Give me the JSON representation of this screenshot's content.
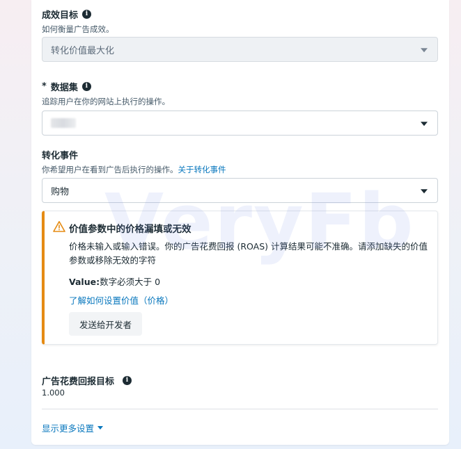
{
  "goal": {
    "title": "成效目标",
    "description": "如何衡量广告成效。",
    "selected": "转化价值最大化"
  },
  "dataset": {
    "required_mark": "*",
    "title": "数据集",
    "description": "追踪用户在你的网站上执行的操作。"
  },
  "conversion_event": {
    "title": "转化事件",
    "description": "你希望用户在看到广告后执行的操作。",
    "link": "关于转化事件",
    "selected": "购物"
  },
  "alert": {
    "title": "价值参数中的价格漏填或无效",
    "body": "价格未输入或输入错误。你的广告花费回报 (ROAS) 计算结果可能不准确。请添加缺失的价值参数或移除无效的字符",
    "value_label": "Value:",
    "value_text": "数字必须大于 0",
    "link": "了解如何设置价值（价格）",
    "button": "发送给开发者",
    "accent_color": "#e58b13"
  },
  "roas": {
    "title": "广告花费回报目标",
    "value": "1.000"
  },
  "more_settings": {
    "label": "显示更多设置"
  },
  "watermark": "VeryFb",
  "colors": {
    "link": "#0a78be",
    "text": "#1c2b33",
    "warning": "#e58b13"
  }
}
